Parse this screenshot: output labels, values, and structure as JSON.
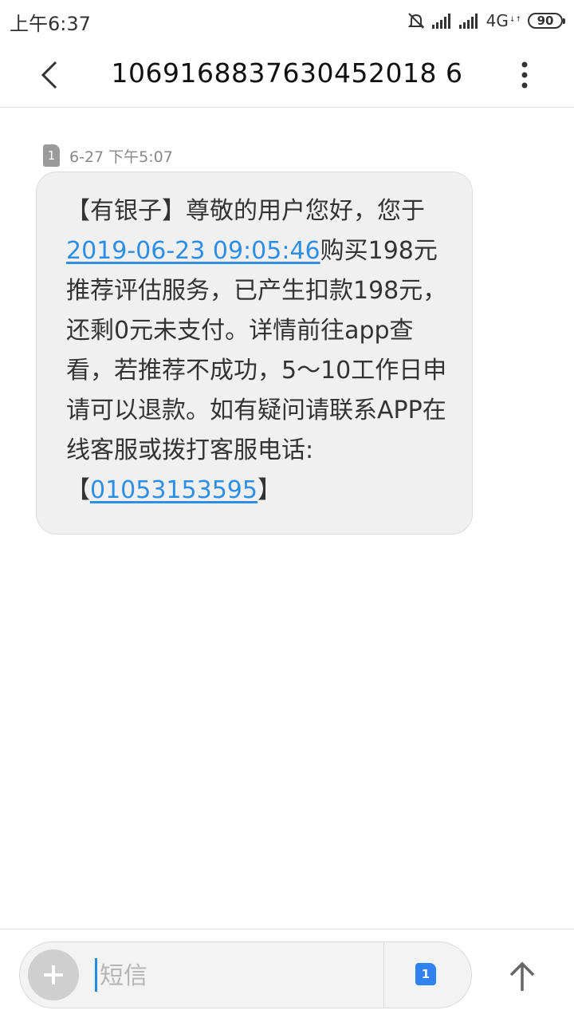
{
  "status_bar": {
    "time": "上午6:37",
    "network": "4G",
    "network_sub": "↓↑",
    "battery": "90"
  },
  "header": {
    "title": "1069168837630452018 6",
    "back_icon": "chevron-left-icon",
    "more_icon": "vertical-dots-icon"
  },
  "message": {
    "sim_slot": "1",
    "time": "6-27 下午5:07",
    "segments": {
      "s1": "【有银子】尊敬的用户您好，您于",
      "date_link": "2019-06-23 09:05:46",
      "s2": "购买198元推荐评估服务，已产生扣款198元，还剩0元未支付。详情前往app查看，若推荐不成功，5～10工作日申请可以退款。如有疑问请联系APP在线客服或拨打客服电话:【",
      "phone_link": "01053153595",
      "s3": "】"
    }
  },
  "compose": {
    "placeholder": "短信",
    "sim_slot": "1",
    "add_icon": "plus-icon",
    "send_icon": "arrow-up-icon"
  },
  "colors": {
    "link": "#2e8ee6",
    "bubble_bg": "#f0f0f0",
    "sim_badge_active": "#2f82f0"
  }
}
